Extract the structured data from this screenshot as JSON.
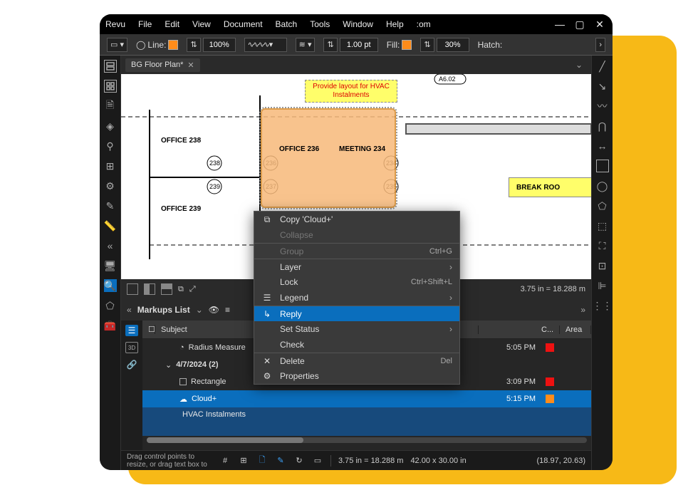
{
  "menu": {
    "items": [
      "Revu",
      "File",
      "Edit",
      "View",
      "Document",
      "Batch",
      "Tools",
      "Window",
      "Help"
    ],
    "overflow": ":om"
  },
  "toolbar": {
    "line_label": "Line:",
    "zoom": "100%",
    "line_width": "1.00 pt",
    "fill_label": "Fill:",
    "opacity": "30%",
    "hatch_label": "Hatch:"
  },
  "tabs": {
    "doc_name": "BG Floor Plan*"
  },
  "floorplan": {
    "note": "Provide layout for HVAC Instalments",
    "rooms": {
      "office238": "OFFICE  238",
      "office239": "OFFICE  239",
      "office236": "OFFICE 236",
      "meeting234": "MEETING  234",
      "breakroom": "BREAK ROO"
    },
    "door_labels": {
      "n238": "238",
      "n239": "239",
      "n236": "236",
      "n237": "237",
      "n234": "234",
      "n235": "235"
    },
    "detail_tag": "A6.02"
  },
  "viewbar": {
    "scale_text": "3.75 in = 18.288 m"
  },
  "markups": {
    "title": "Markups List",
    "columns": {
      "subject": "Subject",
      "c": "C...",
      "area": "Area"
    },
    "tree": {
      "radius_measure": "Radius Measure",
      "group_date": "4/7/2024 (2)",
      "rectangle": "Rectangle",
      "cloud": "Cloud+",
      "reply_text": "HVAC Instalments"
    },
    "times": {
      "t1": "5:05 PM",
      "t2": "3:09 PM",
      "t3": "5:15 PM"
    }
  },
  "context_menu": {
    "copy": "Copy 'Cloud+'",
    "collapse": "Collapse",
    "group": "Group",
    "group_sc": "Ctrl+G",
    "layer": "Layer",
    "lock": "Lock",
    "lock_sc": "Ctrl+Shift+L",
    "legend": "Legend",
    "reply": "Reply",
    "set_status": "Set Status",
    "check": "Check",
    "delete": "Delete",
    "delete_sc": "Del",
    "properties": "Properties"
  },
  "statusbar": {
    "drag_hint": "Drag control points to resize, or drag text box to",
    "scale": "3.75 in = 18.288 m",
    "dims": "42.00 x 30.00 in",
    "coords": "(18.97, 20.63)"
  }
}
